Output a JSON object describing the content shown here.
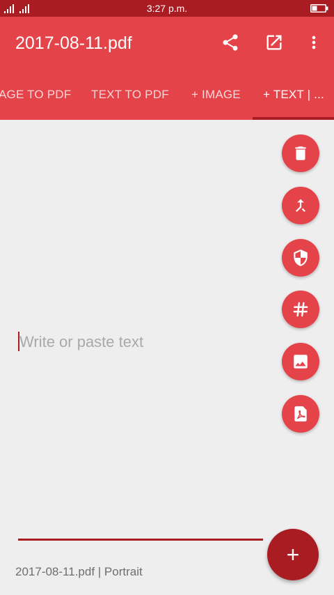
{
  "status_bar": {
    "time": "3:27 p.m.",
    "signal_icon": "signal-icon",
    "battery_icon": "battery-icon"
  },
  "app_bar": {
    "title": "2017-08-11.pdf",
    "actions": [
      "share-icon",
      "open-external-icon",
      "more-vert-icon"
    ]
  },
  "tabs": [
    {
      "label": "AGE TO PDF",
      "active": false
    },
    {
      "label": "TEXT TO PDF",
      "active": false
    },
    {
      "label": "+ IMAGE",
      "active": false
    },
    {
      "label": "+ TEXT | ...",
      "active": true
    }
  ],
  "editor": {
    "placeholder": "Write or paste text"
  },
  "fab_actions": [
    "delete-icon",
    "merge-icon",
    "security-icon",
    "hashtag-icon",
    "image-icon",
    "pdf-icon"
  ],
  "main_fab": {
    "label": "+"
  },
  "footer": {
    "info": "2017-08-11.pdf | Portrait"
  },
  "colors": {
    "primary": "#e5434a",
    "primary_dark": "#a81c22",
    "background": "#efeeef"
  }
}
